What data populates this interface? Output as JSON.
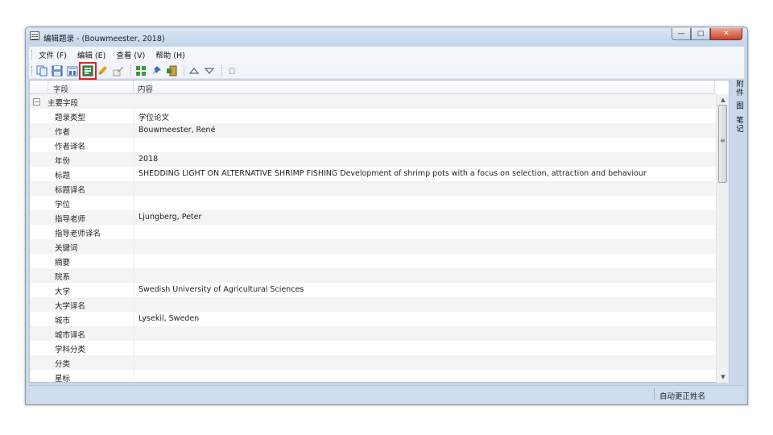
{
  "window": {
    "title": "编辑题录 - (Bouwmeester, 2018)",
    "buttons": {
      "minimize": "—",
      "maximize": "□",
      "close": "✕"
    }
  },
  "menu": [
    "文件 (F)",
    "编辑 (E)",
    "查看 (V)",
    "帮助 (H)"
  ],
  "toolbar": {
    "icons": [
      "copy-icon",
      "save-icon",
      "save-close-icon",
      "record-icon",
      "clean-icon",
      "edit-icon",
      "grid-icon",
      "pin-icon",
      "export-icon",
      "up-arrow-icon",
      "down-arrow-icon",
      "omega-icon"
    ],
    "active_icon": "record-icon",
    "highlight_color": "#e0202a"
  },
  "grid": {
    "columns": {
      "field": "字段",
      "content": "内容"
    },
    "group": {
      "label": "主要字段",
      "toggle": "−"
    },
    "rows": [
      {
        "field": "题录类型",
        "value": "学位论文"
      },
      {
        "field": "作者",
        "value": "Bouwmeester, René"
      },
      {
        "field": "作者译名",
        "value": ""
      },
      {
        "field": "年份",
        "value": "2018"
      },
      {
        "field": "标题",
        "value": "SHEDDING LIGHT ON ALTERNATIVE SHRIMP FISHING    Development of shrimp pots with a focus on selection, attraction and behaviour"
      },
      {
        "field": "标题译名",
        "value": ""
      },
      {
        "field": "学位",
        "value": ""
      },
      {
        "field": "指导老师",
        "value": "Ljungberg, Peter"
      },
      {
        "field": "指导老师译名",
        "value": ""
      },
      {
        "field": "关键词",
        "value": ""
      },
      {
        "field": "摘要",
        "value": ""
      },
      {
        "field": "院系",
        "value": ""
      },
      {
        "field": "大学",
        "value": "Swedish University of Agricultural Sciences"
      },
      {
        "field": "大学译名",
        "value": ""
      },
      {
        "field": "城市",
        "value": "Lysekil, Sweden"
      },
      {
        "field": "城市译名",
        "value": ""
      },
      {
        "field": "学科分类",
        "value": ""
      },
      {
        "field": "分类",
        "value": ""
      },
      {
        "field": "星标",
        "value": ""
      }
    ]
  },
  "side_tabs": [
    "附件",
    "图",
    "笔记"
  ],
  "status": {
    "auto_update": "自动更正姓名"
  }
}
